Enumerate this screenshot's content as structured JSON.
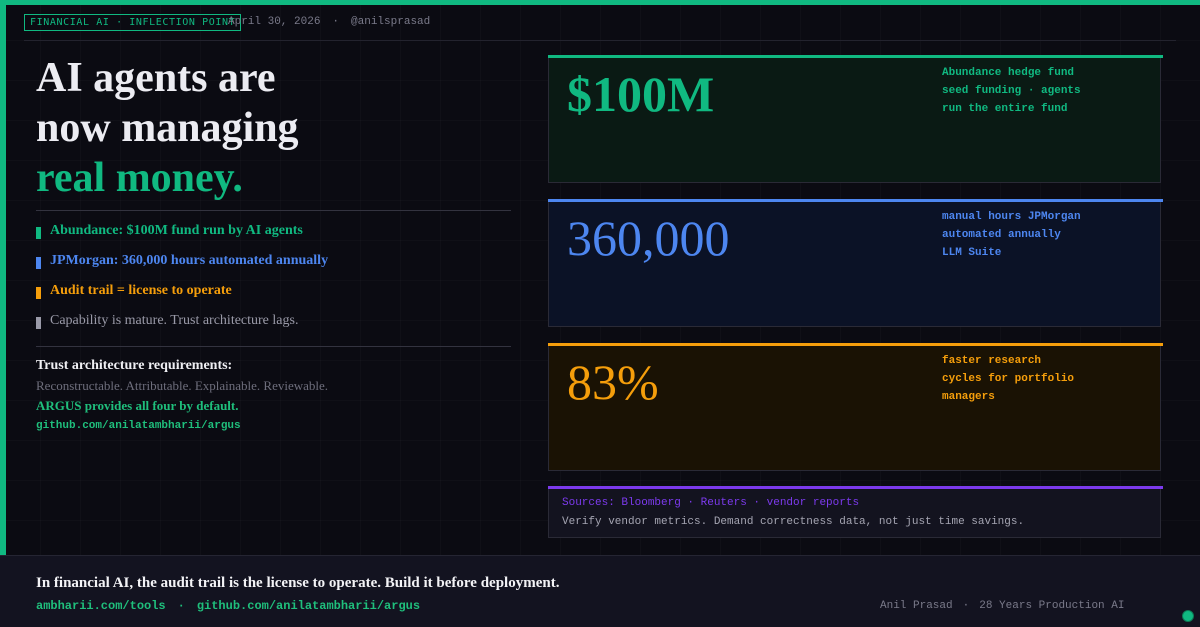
{
  "header": {
    "tag": "FINANCIAL AI · INFLECTION POINT",
    "date": "April 30, 2026",
    "separator": "·",
    "handle": "@anilsprasad"
  },
  "headline": {
    "line1": "AI agents are",
    "line2": "now managing",
    "line3_accent": "real money."
  },
  "bullets": [
    {
      "text": "Abundance: $100M fund run by AI agents",
      "color": "#10b981"
    },
    {
      "text": "JPMorgan: 360,000 hours automated annually",
      "color": "#4d86f0"
    },
    {
      "text": "Audit trail = license to operate",
      "color": "#f59e0b"
    },
    {
      "text": "Capability is mature. Trust architecture lags.",
      "color": "#9a9aa8"
    }
  ],
  "trust": {
    "title": "Trust architecture requirements:",
    "pillars": "Reconstructable. Attributable. Explainable. Reviewable.",
    "argus": "ARGUS provides all four by default.",
    "link": "github.com/anilatambharii/argus"
  },
  "stats": [
    {
      "value": "$100M",
      "desc_lines": [
        "Abundance hedge fund",
        "seed funding · agents",
        "run the entire fund"
      ],
      "color": "#10b981"
    },
    {
      "value": "360,000",
      "desc_lines": [
        "manual hours JPMorgan",
        "automated annually",
        "LLM Suite"
      ],
      "color": "#4d86f0"
    },
    {
      "value": "83%",
      "desc_lines": [
        "faster research",
        "cycles for portfolio",
        "managers"
      ],
      "color": "#f59e0b"
    }
  ],
  "sources": {
    "line": "Sources: Bloomberg · Reuters · vendor reports",
    "note": "Verify vendor metrics. Demand correctness data, not just time savings.",
    "color": "#7c3aed"
  },
  "footer": {
    "tagline": "In financial AI, the audit trail is the license to operate. Build it before deployment.",
    "link1": "ambharii.com/tools",
    "separator": "·",
    "link2": "github.com/anilatambharii/argus",
    "author": "Anil Prasad",
    "credential": "28 Years Production AI"
  },
  "colors": {
    "accent": "#10b981",
    "background": "#0b0b12"
  }
}
